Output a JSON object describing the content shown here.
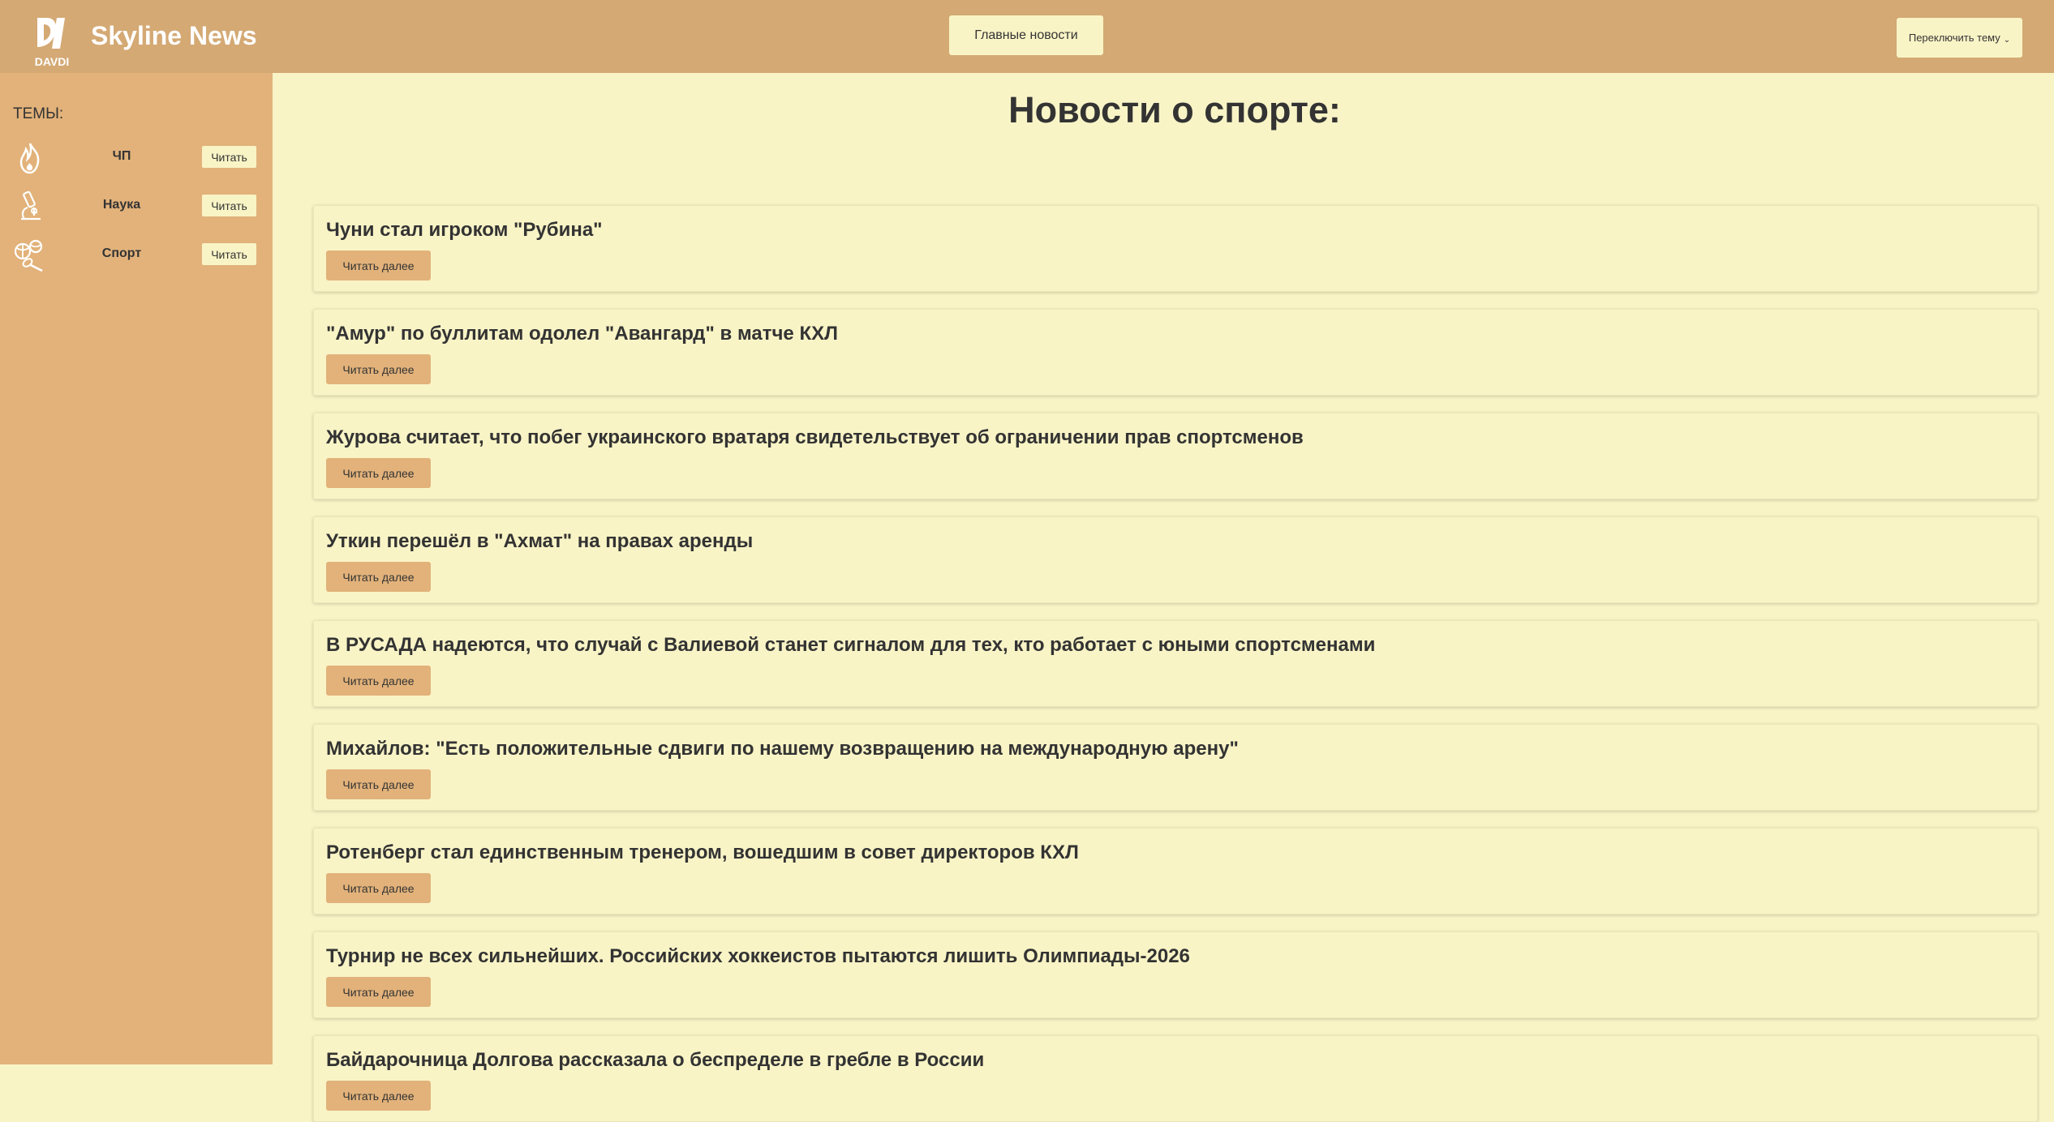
{
  "header": {
    "logo_text": "DAVDI",
    "site_title": "Skyline News",
    "main_news_label": "Главные новости",
    "theme_toggle_label": "Переключить тему",
    "theme_toggle_chevron": "⌄"
  },
  "sidebar": {
    "heading": "ТЕМЫ:",
    "items": [
      {
        "label": "ЧП",
        "icon": "fire-icon",
        "read_label": "Читать"
      },
      {
        "label": "Наука",
        "icon": "microscope-icon",
        "read_label": "Читать"
      },
      {
        "label": "Спорт",
        "icon": "sports-icon",
        "read_label": "Читать"
      }
    ]
  },
  "main": {
    "title": "Новости о спорте:",
    "news": [
      {
        "title": "Чуни стал игроком \"Рубина\"",
        "read_label": "Читать далее"
      },
      {
        "title": "\"Амур\" по буллитам одолел \"Авангард\" в матче КХЛ",
        "read_label": "Читать далее"
      },
      {
        "title": "Журова считает, что побег украинского вратаря свидетельствует об ограничении прав спортсменов",
        "read_label": "Читать далее"
      },
      {
        "title": "Уткин перешёл в \"Ахмат\" на правах аренды",
        "read_label": "Читать далее"
      },
      {
        "title": "В РУСАДА надеются, что случай с Валиевой станет сигналом для тех, кто работает с юными спортсменами",
        "read_label": "Читать далее"
      },
      {
        "title": "Михайлов: \"Есть положительные сдвиги по нашему возвращению на международную арену\"",
        "read_label": "Читать далее"
      },
      {
        "title": "Ротенберг стал единственным тренером, вошедшим в совет директоров КХЛ",
        "read_label": "Читать далее"
      },
      {
        "title": "Турнир не всех сильнейших. Российских хоккеистов пытаются лишить Олимпиады-2026",
        "read_label": "Читать далее"
      },
      {
        "title": "Байдарочница Долгова рассказала о беспределе в гребле в России",
        "read_label": "Читать далее"
      }
    ]
  },
  "colors": {
    "header_bg": "#d4a974",
    "sidebar_bg": "#e2b27a",
    "content_bg": "#f9f4c6",
    "button_accent": "#e2b27a",
    "text": "#333333"
  }
}
